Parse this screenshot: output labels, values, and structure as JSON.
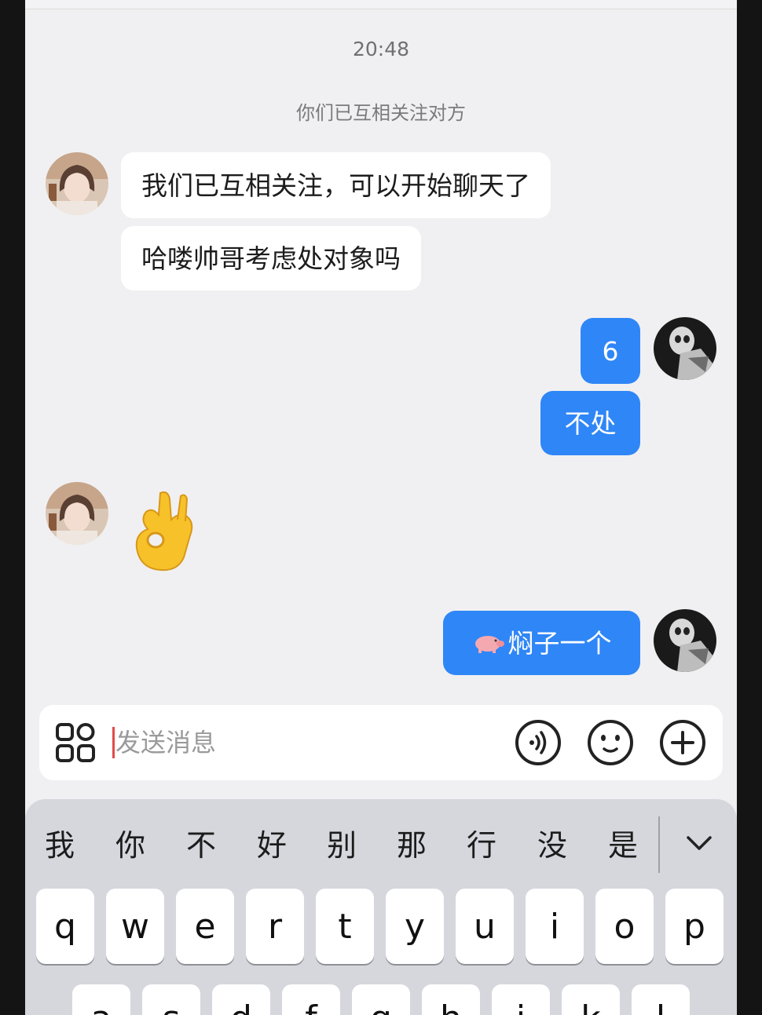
{
  "chat": {
    "timestamp": "20:48",
    "system_note": "你们已互相关注对方",
    "messages": [
      {
        "side": "in",
        "text": "我们已互相关注，可以开始聊天了"
      },
      {
        "side": "in",
        "text": "哈喽帅哥考虑处对象吗"
      },
      {
        "side": "out",
        "text": "6"
      },
      {
        "side": "out",
        "text": "不处"
      },
      {
        "side": "in",
        "emoji": "ok-hand"
      },
      {
        "side": "out",
        "text": "焖子一个",
        "emoji_prefix": "pig"
      }
    ]
  },
  "input_bar": {
    "placeholder": "发送消息",
    "icons": [
      "apps-icon",
      "voice-icon",
      "emoji-icon",
      "plus-icon"
    ]
  },
  "keyboard": {
    "candidates": [
      "我",
      "你",
      "不",
      "好",
      "别",
      "那",
      "行",
      "没",
      "是"
    ],
    "row1": [
      "q",
      "w",
      "e",
      "r",
      "t",
      "y",
      "u",
      "i",
      "o",
      "p"
    ],
    "row2": [
      "a",
      "s",
      "d",
      "f",
      "g",
      "h",
      "j",
      "k",
      "l"
    ]
  },
  "colors": {
    "background": "#f0f0f2",
    "incoming_bubble": "#ffffff",
    "outgoing_bubble": "#2f86f7",
    "keyboard": "#d5d7dd"
  }
}
